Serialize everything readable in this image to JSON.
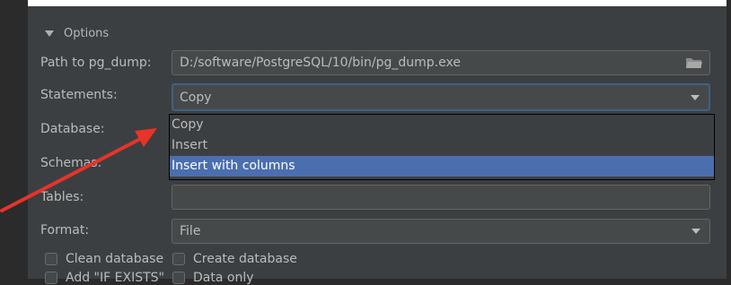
{
  "options": {
    "section_title": "Options",
    "path_label": "Path to pg_dump:",
    "path_value": "D:/software/PostgreSQL/10/bin/pg_dump.exe",
    "statements_label": "Statements:",
    "statements_value": "Copy",
    "statements_options": [
      "Copy",
      "Insert",
      "Insert with columns"
    ],
    "statements_highlighted": "Insert with columns",
    "database_label": "Database:",
    "schemas_label": "Schemas:",
    "tables_label": "Tables:",
    "tables_value": "",
    "format_label": "Format:",
    "format_value": "File",
    "clean_database_label": "Clean database",
    "create_database_label": "Create database",
    "add_if_exists_label": "Add \"IF EXISTS\"",
    "data_only_label": "Data only"
  },
  "colors": {
    "panel_bg": "#3c3f41",
    "selection": "#4b6eaf",
    "annotation_arrow": "#e8332a"
  }
}
